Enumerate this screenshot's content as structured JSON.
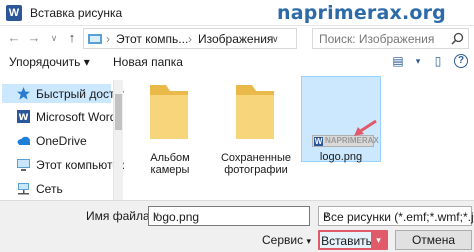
{
  "window": {
    "title": "Вставка рисунка",
    "app_icon_letter": "W",
    "watermark": "naprimerax.org"
  },
  "address": {
    "segments": [
      "Этот компь...",
      "Изображения"
    ],
    "separator": "›",
    "search_placeholder": "Поиск: Изображения"
  },
  "toolbar": {
    "organize_label": "Упорядочить ▾",
    "new_folder_label": "Новая папка"
  },
  "nav": {
    "items": [
      {
        "label": "Быстрый доступ",
        "icon": "star-icon",
        "selected": true
      },
      {
        "label": "Microsoft Word",
        "icon": "word-icon",
        "selected": false
      },
      {
        "label": "OneDrive",
        "icon": "cloud-icon",
        "selected": false
      },
      {
        "label": "Этот компьютер",
        "icon": "computer-icon",
        "selected": false
      },
      {
        "label": "Сеть",
        "icon": "network-icon",
        "selected": false
      }
    ]
  },
  "files": [
    {
      "name": "Альбом камеры",
      "type": "folder"
    },
    {
      "name": "Сохраненные фотографии",
      "type": "folder"
    },
    {
      "name": "logo.png",
      "type": "image",
      "selected": true,
      "thumbnail_text": "NAPRIMERAX"
    }
  ],
  "footer": {
    "filename_label": "Имя файла:",
    "filename_value": "logo.png",
    "filetype_value": "Все рисунки (*.emf;*.wmf;*.jpg",
    "service_label": "Сервис",
    "insert_label": "Вставить",
    "cancel_label": "Отмена"
  },
  "colors": {
    "accent": "#2b579a",
    "selection": "#cce8ff",
    "highlight": "#e05a6a",
    "folder": "#f5cf6b"
  }
}
